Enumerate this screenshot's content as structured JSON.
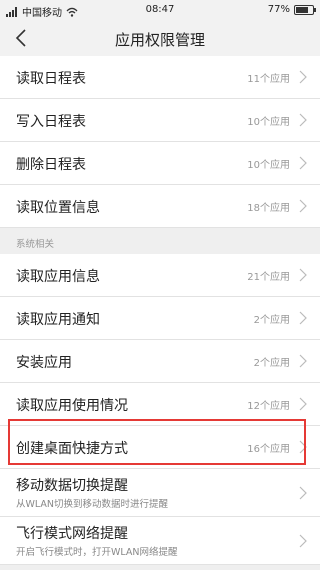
{
  "status_bar": {
    "carrier": "中国移动",
    "time": "08:47",
    "battery": "77%",
    "battery_level": 0.77
  },
  "nav": {
    "title": "应用权限管理"
  },
  "groups": [
    {
      "items": [
        {
          "label": "读取日程表",
          "count": "11个应用"
        },
        {
          "label": "写入日程表",
          "count": "10个应用"
        },
        {
          "label": "删除日程表",
          "count": "10个应用"
        },
        {
          "label": "读取位置信息",
          "count": "18个应用"
        }
      ]
    },
    {
      "header": "系统相关",
      "items": [
        {
          "label": "读取应用信息",
          "count": "21个应用"
        },
        {
          "label": "读取应用通知",
          "count": "2个应用"
        },
        {
          "label": "安装应用",
          "count": "2个应用"
        },
        {
          "label": "读取应用使用情况",
          "count": "12个应用"
        },
        {
          "label": "创建桌面快捷方式",
          "count": "16个应用"
        },
        {
          "label": "移动数据切换提醒",
          "sub": "从WLAN切换到移动数据时进行提醒"
        },
        {
          "label": "飞行模式网络提醒",
          "sub": "开启飞行模式时，打开WLAN网络提醒"
        }
      ]
    }
  ],
  "colors": {
    "highlight": "#e53935",
    "background": "#efefef"
  }
}
